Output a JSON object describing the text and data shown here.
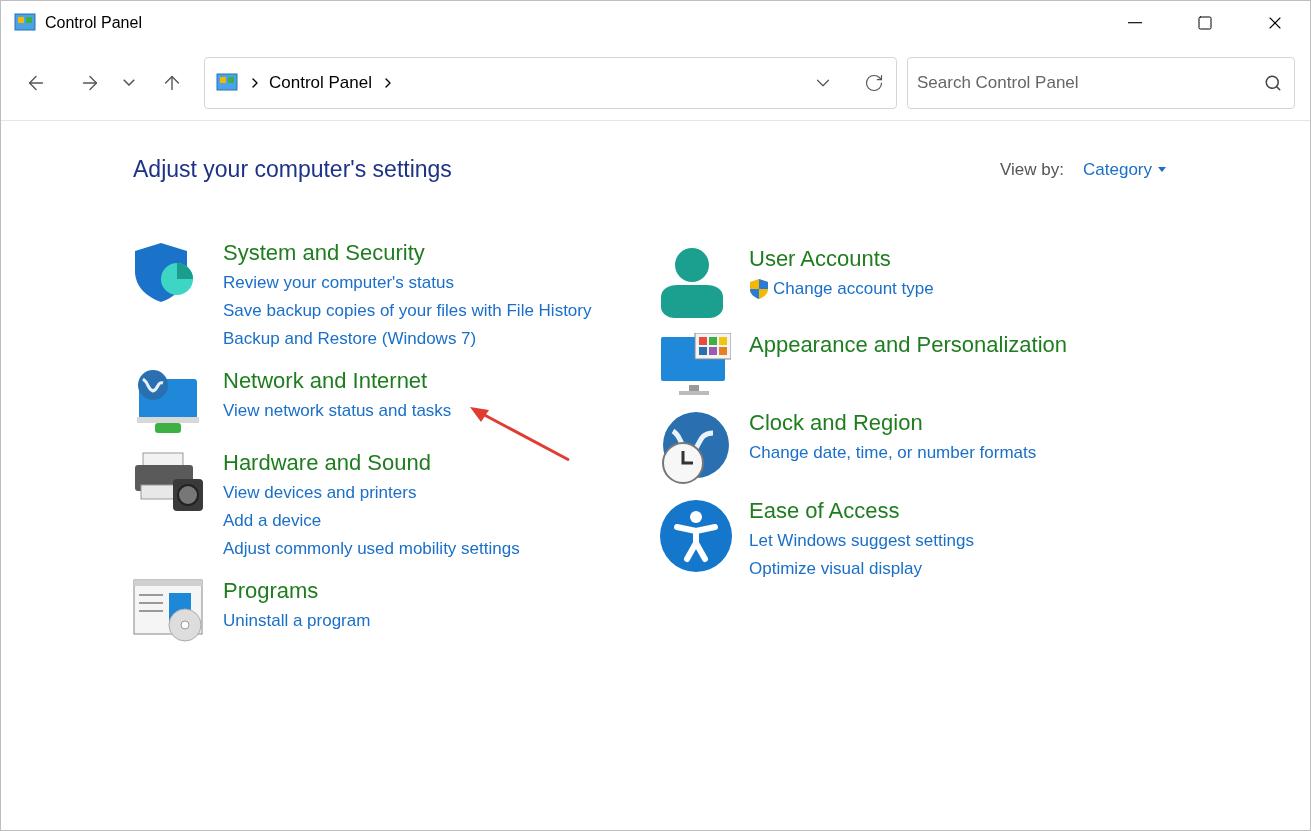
{
  "window": {
    "title": "Control Panel"
  },
  "address": {
    "crumbs": [
      "Control Panel"
    ]
  },
  "search": {
    "placeholder": "Search Control Panel"
  },
  "heading": "Adjust your computer's settings",
  "view_by": {
    "label": "View by:",
    "value": "Category"
  },
  "left_categories": [
    {
      "title": "System and Security",
      "links": [
        {
          "text": "Review your computer's status",
          "shield": false
        },
        {
          "text": "Save backup copies of your files with File History",
          "shield": false
        },
        {
          "text": "Backup and Restore (Windows 7)",
          "shield": false
        }
      ]
    },
    {
      "title": "Network and Internet",
      "links": [
        {
          "text": "View network status and tasks",
          "shield": false
        }
      ]
    },
    {
      "title": "Hardware and Sound",
      "links": [
        {
          "text": "View devices and printers",
          "shield": false
        },
        {
          "text": "Add a device",
          "shield": false
        },
        {
          "text": "Adjust commonly used mobility settings",
          "shield": false
        }
      ]
    },
    {
      "title": "Programs",
      "links": [
        {
          "text": "Uninstall a program",
          "shield": false
        }
      ]
    }
  ],
  "right_categories": [
    {
      "title": "User Accounts",
      "links": [
        {
          "text": "Change account type",
          "shield": true
        }
      ]
    },
    {
      "title": "Appearance and Personalization"
    },
    {
      "title": "Clock and Region",
      "links": [
        {
          "text": "Change date, time, or number formats",
          "shield": false
        }
      ]
    },
    {
      "title": "Ease of Access",
      "links": [
        {
          "text": "Let Windows suggest settings",
          "shield": false
        },
        {
          "text": "Optimize visual display",
          "shield": false
        }
      ]
    }
  ]
}
